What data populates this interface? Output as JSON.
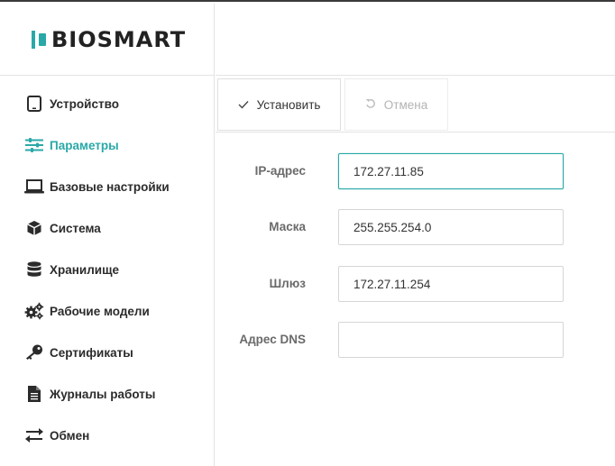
{
  "logo": {
    "text": "BIOSMART"
  },
  "sidebar": {
    "items": [
      {
        "label": "Устройство",
        "icon": "tablet-icon",
        "active": false
      },
      {
        "label": "Параметры",
        "icon": "sliders-icon",
        "active": true
      },
      {
        "label": "Базовые настройки",
        "icon": "laptop-icon",
        "active": false
      },
      {
        "label": "Система",
        "icon": "cube-icon",
        "active": false
      },
      {
        "label": "Хранилище",
        "icon": "database-icon",
        "active": false
      },
      {
        "label": "Рабочие модели",
        "icon": "gears-icon",
        "active": false
      },
      {
        "label": "Сертификаты",
        "icon": "key-icon",
        "active": false
      },
      {
        "label": "Журналы работы",
        "icon": "file-icon",
        "active": false
      },
      {
        "label": "Обмен",
        "icon": "exchange-icon",
        "active": false
      }
    ]
  },
  "toolbar": {
    "install_label": "Установить",
    "cancel_label": "Отмена"
  },
  "form": {
    "ip": {
      "label": "IP-адрес",
      "value": "172.27.11.85"
    },
    "mask": {
      "label": "Маска",
      "value": "255.255.254.0"
    },
    "gateway": {
      "label": "Шлюз",
      "value": "172.27.11.254"
    },
    "dns": {
      "label": "Адрес DNS",
      "value": ""
    }
  },
  "colors": {
    "accent": "#2aa8a8",
    "text": "#2b2b2b",
    "label": "#6a6a6a",
    "border": "#e3e3e3"
  }
}
